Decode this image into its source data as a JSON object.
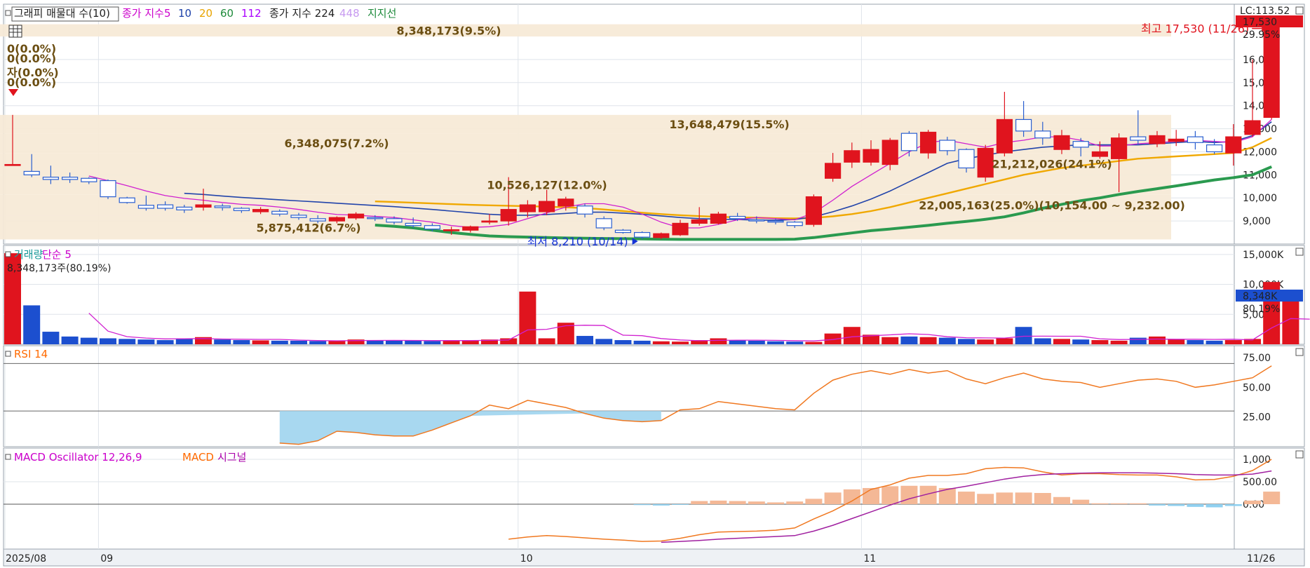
{
  "chart_data": {
    "type": "candlestick",
    "price_pane": {
      "legend": [
        {
          "text": "그래피 매물대 수(10)",
          "color": "#222222",
          "boxed": true
        },
        {
          "text": "종가 지수",
          "color": "#cc00cc"
        },
        {
          "text": "5",
          "color": "#cc00cc"
        },
        {
          "text": "10",
          "color": "#1a3fa8"
        },
        {
          "text": "20",
          "color": "#e8a400"
        },
        {
          "text": "60",
          "color": "#1d8a3a"
        },
        {
          "text": "112",
          "color": "#aa00ff"
        },
        {
          "text": "종가 지수 224",
          "color": "#222222"
        },
        {
          "text": "448",
          "color": "#c79af0"
        },
        {
          "text": "지지선",
          "color": "#1d8a3a"
        }
      ],
      "ylim": [
        8000,
        18400
      ],
      "y_ticks": [
        "9,000",
        "10,000",
        "11,000",
        "12,000",
        "13,000",
        "14,000",
        "15,000",
        "16,000"
      ],
      "y_tick_values": [
        9000,
        10000,
        11000,
        12000,
        13000,
        14000,
        15000,
        16000
      ],
      "last_price_label": "17,530",
      "change_label": "29.95%",
      "top_right_label": "LC:113.52",
      "volume_profile": [
        {
          "lo": 17000,
          "hi": 17530,
          "label": "8,348,173(9.5%)"
        },
        {
          "lo": 12800,
          "hi": 13600,
          "label": "13,648,479(15.5%)"
        },
        {
          "lo": 11950,
          "hi": 12800,
          "label": "6,348,075(7.2%)"
        },
        {
          "lo": 11000,
          "hi": 11950,
          "label": "21,212,026(24.1%)"
        },
        {
          "lo": 10154,
          "hi": 11000,
          "label": "10,526,127(12.0%)"
        },
        {
          "lo": 9232,
          "hi": 10154,
          "label": "22,005,163(25.0%)(10,154.00 ~ 9,232.00)"
        },
        {
          "lo": 8200,
          "hi": 9232,
          "label": "5,875,412(6.7%)"
        }
      ],
      "candles": [
        [
          11430,
          11450,
          13600,
          11400
        ],
        [
          11150,
          11000,
          11900,
          10900
        ],
        [
          10900,
          10800,
          11400,
          10600
        ],
        [
          10900,
          10800,
          11100,
          10650
        ],
        [
          10850,
          10700,
          10900,
          10600
        ],
        [
          10750,
          10050,
          10800,
          9950
        ],
        [
          10000,
          9800,
          10050,
          9750
        ],
        [
          9680,
          9550,
          10100,
          9450
        ],
        [
          9700,
          9550,
          9850,
          9450
        ],
        [
          9600,
          9480,
          9700,
          9350
        ],
        [
          9600,
          9700,
          10400,
          9450
        ],
        [
          9650,
          9580,
          9750,
          9450
        ],
        [
          9550,
          9450,
          9600,
          9350
        ],
        [
          9400,
          9500,
          9600,
          9300
        ],
        [
          9420,
          9300,
          9500,
          9200
        ],
        [
          9250,
          9150,
          9350,
          9050
        ],
        [
          9100,
          9000,
          9250,
          8900
        ],
        [
          9000,
          9150,
          9200,
          8900
        ],
        [
          9130,
          9300,
          9380,
          9050
        ],
        [
          9150,
          9100,
          9250,
          9000
        ],
        [
          9100,
          8950,
          9200,
          8850
        ],
        [
          8900,
          8800,
          9150,
          8700
        ],
        [
          8800,
          8650,
          8900,
          8550
        ],
        [
          8600,
          8620,
          8750,
          8400
        ],
        [
          8600,
          8750,
          8800,
          8500
        ],
        [
          8950,
          9000,
          9300,
          8850
        ],
        [
          9000,
          9500,
          10900,
          8800
        ],
        [
          9400,
          9700,
          9900,
          9150
        ],
        [
          9400,
          9850,
          10350,
          9250
        ],
        [
          9650,
          9950,
          10050,
          9450
        ],
        [
          9650,
          9300,
          9750,
          9150
        ],
        [
          9100,
          8700,
          9200,
          8600
        ],
        [
          8600,
          8500,
          8650,
          8450
        ],
        [
          8500,
          8300,
          8550,
          8210
        ],
        [
          8280,
          8450,
          8500,
          8210
        ],
        [
          8400,
          8900,
          9050,
          8350
        ],
        [
          8900,
          9050,
          9600,
          8800
        ],
        [
          8900,
          9300,
          9400,
          8850
        ],
        [
          9200,
          9100,
          9350,
          9000
        ],
        [
          9050,
          9000,
          9200,
          8900
        ],
        [
          9000,
          8950,
          9100,
          8850
        ],
        [
          8950,
          8800,
          9000,
          8700
        ],
        [
          8850,
          10050,
          10150,
          8750
        ],
        [
          10850,
          11500,
          11950,
          10700
        ],
        [
          11550,
          12050,
          12400,
          11300
        ],
        [
          11550,
          12100,
          12500,
          11400
        ],
        [
          11450,
          12500,
          12600,
          11200
        ],
        [
          12800,
          12050,
          12900,
          11800
        ],
        [
          11950,
          12850,
          12950,
          11700
        ],
        [
          12500,
          12050,
          12650,
          11850
        ],
        [
          12100,
          11300,
          12150,
          11100
        ],
        [
          10900,
          12150,
          12300,
          10700
        ],
        [
          11950,
          13400,
          14600,
          11800
        ],
        [
          13400,
          12900,
          14200,
          12650
        ],
        [
          12900,
          12600,
          13300,
          12300
        ],
        [
          12100,
          12700,
          12950,
          11900
        ],
        [
          12450,
          12200,
          12600,
          11800
        ],
        [
          11800,
          12000,
          12450,
          11700
        ],
        [
          11700,
          12600,
          12800,
          10250
        ],
        [
          12650,
          12500,
          13800,
          12300
        ],
        [
          12350,
          12700,
          12900,
          12200
        ],
        [
          12450,
          12550,
          12950,
          12250
        ],
        [
          12650,
          12400,
          12900,
          12100
        ],
        [
          12300,
          12000,
          12550,
          11900
        ],
        [
          11950,
          12650,
          13200,
          11400
        ],
        [
          12750,
          13350,
          16000,
          12650
        ],
        [
          13490,
          17530,
          17530,
          13400
        ]
      ],
      "ma5": [
        null,
        null,
        null,
        null,
        10950,
        10750,
        10530,
        10300,
        10100,
        9980,
        9900,
        9800,
        9720,
        9680,
        9600,
        9500,
        9380,
        9280,
        9250,
        9200,
        9150,
        9050,
        8950,
        8800,
        8720,
        8750,
        8850,
        9100,
        9350,
        9600,
        9750,
        9750,
        9600,
        9300,
        8950,
        8700,
        8700,
        8850,
        9050,
        9150,
        9100,
        9050,
        9350,
        9900,
        10500,
        11000,
        11500,
        12000,
        12400,
        12500,
        12350,
        12200,
        12400,
        12500,
        12650,
        12650,
        12500,
        12250,
        12250,
        12350,
        12400,
        12450,
        12500,
        12450,
        12400,
        12650,
        13400
      ],
      "ma10": [
        null,
        null,
        null,
        null,
        null,
        null,
        null,
        null,
        null,
        10200,
        10150,
        10080,
        10020,
        9970,
        9920,
        9870,
        9820,
        9770,
        9720,
        9670,
        9620,
        9560,
        9500,
        9430,
        9360,
        9290,
        9250,
        9250,
        9280,
        9330,
        9380,
        9380,
        9340,
        9290,
        9220,
        9150,
        9100,
        9080,
        9060,
        9040,
        9030,
        9060,
        9180,
        9400,
        9650,
        9950,
        10300,
        10700,
        11100,
        11500,
        11700,
        11850,
        12000,
        12100,
        12200,
        12250,
        12300,
        12300,
        12300,
        12300,
        12350,
        12400,
        12450,
        12400,
        12450,
        12700,
        13300
      ],
      "ma20": [
        null,
        null,
        null,
        null,
        null,
        null,
        null,
        null,
        null,
        null,
        null,
        null,
        null,
        null,
        null,
        null,
        null,
        null,
        null,
        9850,
        9820,
        9790,
        9760,
        9730,
        9700,
        9680,
        9660,
        9640,
        9620,
        9590,
        9560,
        9500,
        9430,
        9360,
        9300,
        9250,
        9210,
        9180,
        9160,
        9140,
        9120,
        9110,
        9130,
        9200,
        9300,
        9430,
        9600,
        9800,
        10000,
        10200,
        10400,
        10600,
        10800,
        11000,
        11150,
        11300,
        11400,
        11500,
        11600,
        11700,
        11750,
        11800,
        11850,
        11900,
        11950,
        12200,
        12600
      ],
      "ma60": [
        null,
        null,
        null,
        null,
        null,
        null,
        null,
        null,
        null,
        null,
        null,
        null,
        null,
        null,
        null,
        null,
        null,
        null,
        null,
        8820,
        8770,
        8700,
        8600,
        8500,
        8420,
        8350,
        8320,
        8300,
        8280,
        8260,
        8250,
        8240,
        8230,
        8220,
        8210,
        8200,
        8200,
        8200,
        8200,
        8200,
        8200,
        8210,
        8280,
        8380,
        8480,
        8580,
        8650,
        8730,
        8810,
        8900,
        8980,
        9070,
        9180,
        9350,
        9550,
        9720,
        9880,
        10000,
        10150,
        10280,
        10400,
        10520,
        10650,
        10780,
        10880,
        11000,
        11350
      ],
      "annotations": {
        "high": {
          "text": "최고 17,530 (11/26)",
          "value": 17530,
          "index": 66,
          "color": "#e0141e"
        },
        "low": {
          "text": "최저 8,210 (10/14)",
          "value": 8210,
          "index": 33,
          "color": "#1533d6"
        },
        "left_labels": [
          "0(0.0%)",
          "0(0.0%)",
          "자(0.0%)",
          "0(0.0%)"
        ]
      }
    },
    "volume_pane": {
      "legend": [
        {
          "text": "거래량",
          "color": "#1a9a9a"
        },
        {
          "text": "단순 5",
          "color": "#cc00cc"
        }
      ],
      "info": "8,348,173주(80.19%)",
      "ylim": [
        0,
        16500
      ],
      "y_ticks": [
        "5,000K",
        "10,000K",
        "15,000K"
      ],
      "y_tick_values": [
        5000,
        10000,
        15000
      ],
      "last_label": "8,348K",
      "last_sub_label": "80.19%",
      "unit": "K",
      "values": [
        15200,
        6500,
        2100,
        1300,
        1100,
        1000,
        900,
        800,
        700,
        900,
        1200,
        800,
        700,
        650,
        600,
        600,
        550,
        550,
        800,
        700,
        600,
        600,
        550,
        600,
        700,
        800,
        1000,
        8800,
        1000,
        3600,
        1400,
        900,
        700,
        600,
        500,
        450,
        700,
        1000,
        700,
        600,
        500,
        450,
        400,
        1800,
        2900,
        1600,
        1200,
        1300,
        1200,
        1100,
        900,
        800,
        1000,
        2900,
        1000,
        900,
        800,
        700,
        600,
        1100,
        1300,
        800,
        700,
        600,
        700,
        900,
        10400,
        8348
      ],
      "ma5": [
        null,
        null,
        null,
        null,
        5200,
        2200,
        1280,
        1040,
        900,
        920,
        960,
        880,
        840,
        820,
        820,
        700,
        620,
        580,
        620,
        640,
        660,
        640,
        620,
        620,
        620,
        650,
        720,
        2400,
        2500,
        3100,
        3180,
        3140,
        1520,
        1440,
        960,
        720,
        600,
        650,
        690,
        690,
        660,
        610,
        560,
        800,
        1250,
        1430,
        1580,
        1750,
        1640,
        1260,
        1100,
        1060,
        1040,
        1350,
        1360,
        1350,
        1340,
        920,
        800,
        820,
        880,
        840,
        840,
        820,
        840,
        740,
        2730,
        4290,
        4200
      ]
    },
    "rsi_pane": {
      "legend": [
        {
          "text": "RSI 14",
          "color": "#ff6a00"
        }
      ],
      "ylim": [
        0,
        85
      ],
      "y_ticks": [
        "25.00",
        "50.00",
        "75.00"
      ],
      "y_tick_values": [
        25,
        50,
        75
      ],
      "upper": 70,
      "lower": 30,
      "values": [
        null,
        null,
        null,
        null,
        null,
        null,
        null,
        null,
        null,
        null,
        null,
        null,
        null,
        null,
        3,
        2,
        5,
        13,
        12,
        10,
        9,
        9,
        14,
        20,
        26,
        35,
        32,
        39,
        36,
        33,
        28,
        24,
        22,
        21,
        22,
        31,
        32,
        38,
        36,
        34,
        32,
        31,
        45,
        56,
        61,
        64,
        61,
        65,
        62,
        64,
        57,
        53,
        58,
        62,
        57,
        55,
        54,
        50,
        53,
        56,
        57,
        55,
        50,
        52,
        55,
        58,
        68
      ]
    },
    "macd_pane": {
      "legend": [
        {
          "text": "MACD Oscillator 12,26,9",
          "color": "#cc00cc"
        },
        {
          "text": "MACD",
          "color": "#ff6a00"
        },
        {
          "text": "시그널",
          "color": "#aa00aa"
        }
      ],
      "ylim": [
        -1000,
        1250
      ],
      "y_ticks": [
        "0.00",
        "500.00",
        "1,000"
      ],
      "y_tick_values": [
        0,
        500,
        1000
      ],
      "macd": [
        null,
        null,
        null,
        null,
        null,
        null,
        null,
        null,
        null,
        null,
        null,
        null,
        null,
        null,
        null,
        null,
        null,
        null,
        null,
        null,
        null,
        null,
        null,
        null,
        null,
        null,
        -780,
        -730,
        -700,
        -720,
        -750,
        -780,
        -800,
        -830,
        -820,
        -760,
        -680,
        -620,
        -610,
        -600,
        -580,
        -530,
        -330,
        -150,
        70,
        330,
        430,
        580,
        640,
        640,
        680,
        790,
        820,
        810,
        720,
        650,
        680,
        680,
        660,
        650,
        650,
        610,
        540,
        550,
        620,
        750,
        1000
      ],
      "signal": [
        null,
        null,
        null,
        null,
        null,
        null,
        null,
        null,
        null,
        null,
        null,
        null,
        null,
        null,
        null,
        null,
        null,
        null,
        null,
        null,
        null,
        null,
        null,
        null,
        null,
        null,
        null,
        null,
        null,
        null,
        null,
        null,
        null,
        null,
        -850,
        -830,
        -810,
        -780,
        -760,
        -740,
        -720,
        -700,
        -600,
        -470,
        -320,
        -170,
        -20,
        120,
        230,
        330,
        400,
        480,
        560,
        620,
        660,
        680,
        690,
        700,
        700,
        700,
        690,
        680,
        660,
        650,
        650,
        670,
        740
      ],
      "oscillator": [
        null,
        null,
        null,
        null,
        null,
        null,
        null,
        null,
        null,
        null,
        null,
        null,
        null,
        null,
        null,
        null,
        null,
        null,
        null,
        null,
        null,
        null,
        null,
        null,
        null,
        null,
        null,
        null,
        null,
        null,
        null,
        null,
        null,
        -20,
        -30,
        -10,
        70,
        80,
        70,
        60,
        40,
        60,
        120,
        260,
        330,
        360,
        400,
        410,
        410,
        360,
        280,
        230,
        260,
        260,
        250,
        160,
        100,
        20,
        20,
        20,
        -30,
        -40,
        -60,
        -70,
        -40,
        80,
        280
      ]
    },
    "x_axis": {
      "ticks": [
        {
          "label": "2025/08",
          "index": -4
        },
        {
          "label": "09",
          "index": 5
        },
        {
          "label": "10",
          "index": 27
        },
        {
          "label": "11",
          "index": 45
        }
      ],
      "right_label": "11/26"
    }
  }
}
